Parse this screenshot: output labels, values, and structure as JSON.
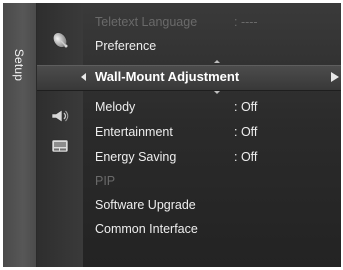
{
  "menu": {
    "section_label": "Setup",
    "nav_icons": [
      "satellite-dish-icon",
      "gear-icon",
      "speaker-icon",
      "input-card-icon"
    ],
    "items": [
      {
        "label": "Teletext Language",
        "value": ": ----"
      },
      {
        "label": "Preference",
        "value": ""
      },
      {
        "label": "Wall-Mount Adjustment",
        "value": ""
      },
      {
        "label": "Melody",
        "value": ": Off"
      },
      {
        "label": "Entertainment",
        "value": ": Off"
      },
      {
        "label": "Energy Saving",
        "value": ": Off"
      },
      {
        "label": "PIP",
        "value": ""
      },
      {
        "label": "Software Upgrade",
        "value": ""
      },
      {
        "label": "Common Interface",
        "value": ""
      }
    ]
  },
  "colors": {
    "panel_bg": "#2b2b2b",
    "text": "#eeeeee",
    "text_disabled": "#6a6a6a",
    "highlight": "#424242"
  }
}
